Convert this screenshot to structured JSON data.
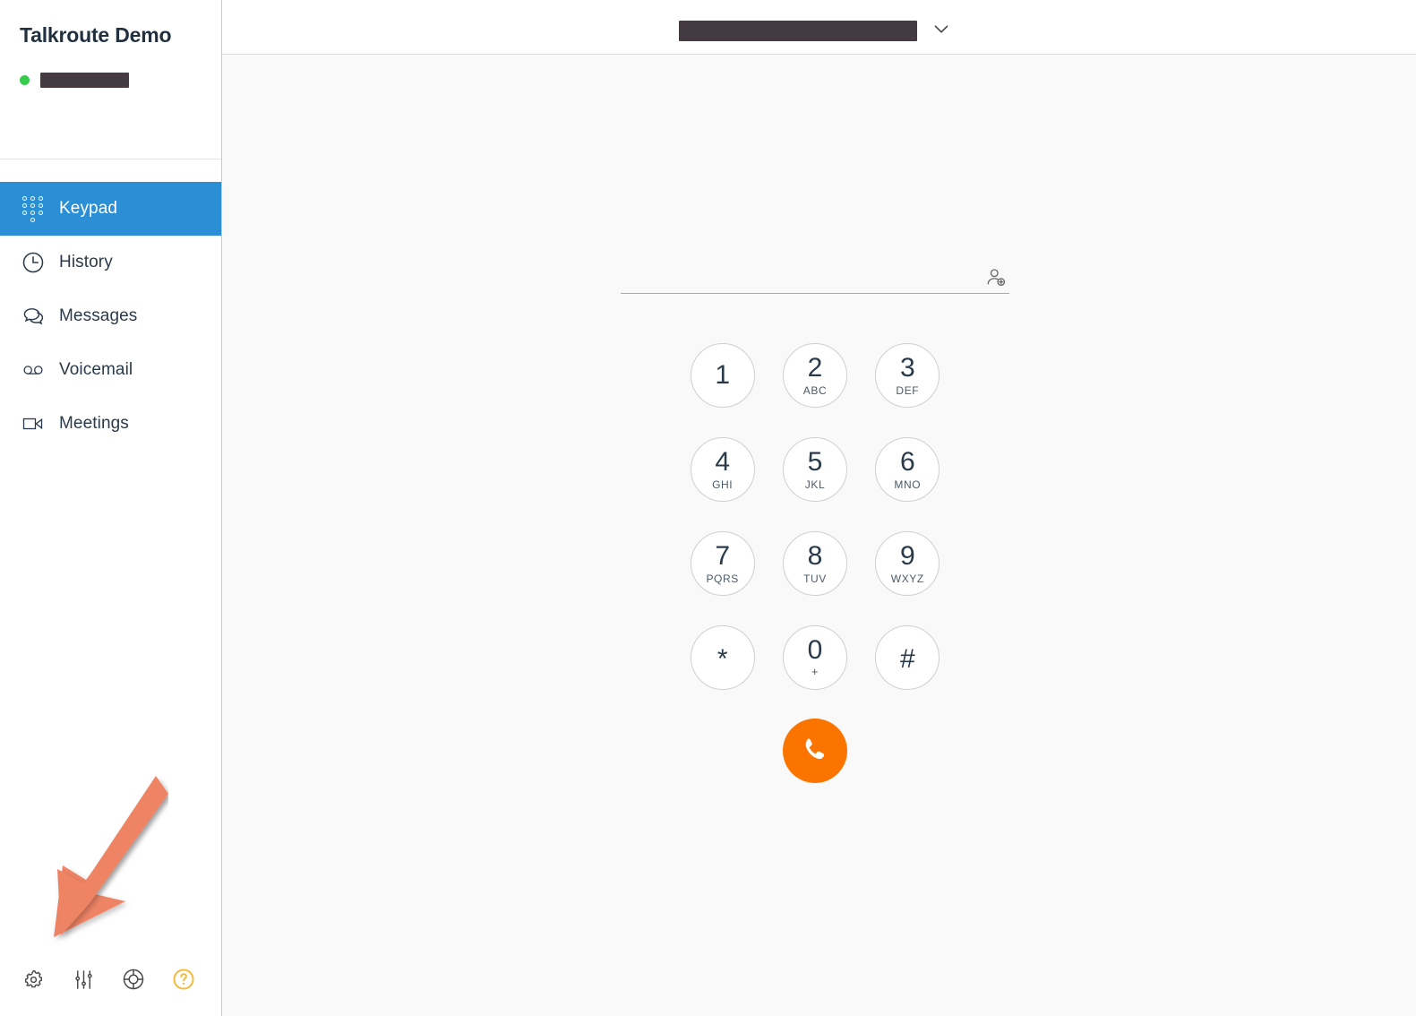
{
  "sidebar": {
    "account_title": "Talkroute Demo",
    "status": {
      "indicator_color": "#34cc4b",
      "user_name_redacted": true
    },
    "nav_items": [
      {
        "id": "keypad",
        "label": "Keypad",
        "icon": "keypad-icon",
        "active": true
      },
      {
        "id": "history",
        "label": "History",
        "icon": "clock-icon",
        "active": false
      },
      {
        "id": "messages",
        "label": "Messages",
        "icon": "chat-icon",
        "active": false
      },
      {
        "id": "voicemail",
        "label": "Voicemail",
        "icon": "voicemail-icon",
        "active": false
      },
      {
        "id": "meetings",
        "label": "Meetings",
        "icon": "video-icon",
        "active": false
      }
    ],
    "footer_icons": [
      {
        "id": "settings",
        "icon": "gear-icon"
      },
      {
        "id": "preferences",
        "icon": "sliders-icon"
      },
      {
        "id": "support",
        "icon": "life-ring-icon"
      },
      {
        "id": "help",
        "icon": "question-circle-icon",
        "color": "#f6b93b"
      }
    ],
    "active_highlight_color": "#2a8fd4"
  },
  "header": {
    "caller_id_redacted": true,
    "dropdown_icon": "chevron-down-icon"
  },
  "dialer": {
    "input_value": "",
    "input_placeholder": "",
    "add_contact_icon": "add-contact-icon",
    "keys": [
      {
        "digit": "1",
        "letters": ""
      },
      {
        "digit": "2",
        "letters": "ABC"
      },
      {
        "digit": "3",
        "letters": "DEF"
      },
      {
        "digit": "4",
        "letters": "GHI"
      },
      {
        "digit": "5",
        "letters": "JKL"
      },
      {
        "digit": "6",
        "letters": "MNO"
      },
      {
        "digit": "7",
        "letters": "PQRS"
      },
      {
        "digit": "8",
        "letters": "TUV"
      },
      {
        "digit": "9",
        "letters": "WXYZ"
      },
      {
        "digit": "*",
        "letters": ""
      },
      {
        "digit": "0",
        "letters": "+"
      },
      {
        "digit": "#",
        "letters": ""
      }
    ],
    "call_button": {
      "icon": "phone-icon",
      "color": "#fb7400"
    }
  },
  "annotation": {
    "arrow_color": "#ef8465",
    "points_to": "settings-gear-icon"
  }
}
